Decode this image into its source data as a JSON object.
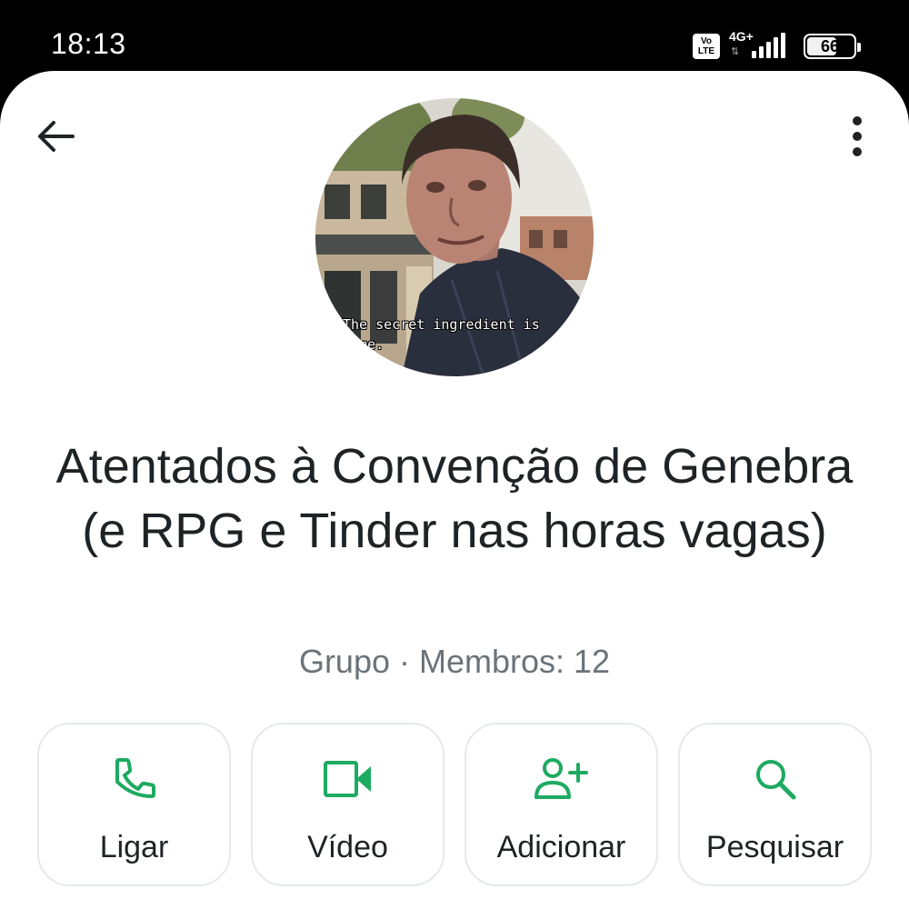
{
  "status_bar": {
    "time": "18:13",
    "volte_top": "Vo",
    "volte_bottom": "LTE",
    "network": "4G+",
    "battery": "66",
    "battery_level": 0.66
  },
  "header": {
    "back_icon": "arrow-left-icon",
    "more_icon": "more-vertical-icon"
  },
  "profile": {
    "avatar_caption_line1": "The secret ingredient is",
    "avatar_caption_line2": "lime.",
    "name": "Atentados à Convenção de Genebra (e RPG e Tinder nas horas vagas)",
    "meta": "Grupo · Membros: 12"
  },
  "actions": [
    {
      "label": "Ligar",
      "icon": "phone-icon"
    },
    {
      "label": "Vídeo",
      "icon": "video-camera-icon"
    },
    {
      "label": "Adicionar",
      "icon": "add-person-icon"
    },
    {
      "label": "Pesquisar",
      "icon": "search-icon"
    }
  ],
  "colors": {
    "accent": "#1DAA61",
    "text_primary": "#1F2326",
    "text_secondary": "#6B7378",
    "card_border": "#E6E9EA"
  }
}
